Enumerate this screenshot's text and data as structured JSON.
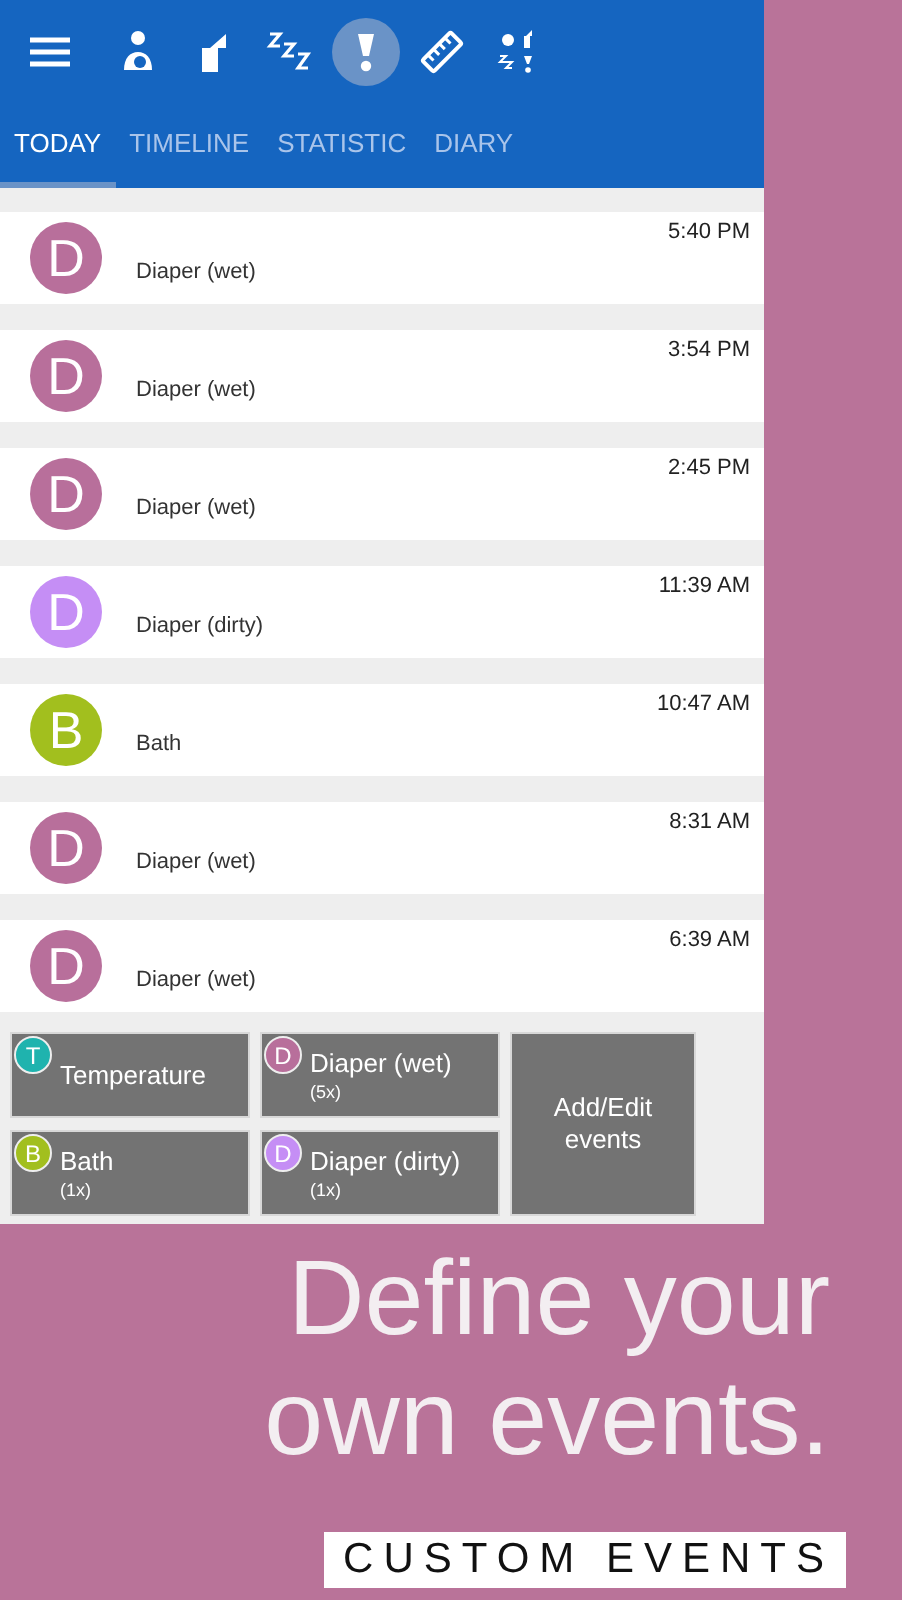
{
  "tools": [
    {
      "kind": "feeding",
      "selected": false
    },
    {
      "kind": "pumping",
      "selected": false
    },
    {
      "kind": "sleep",
      "selected": false
    },
    {
      "kind": "event",
      "selected": true
    },
    {
      "kind": "growth",
      "selected": false
    },
    {
      "kind": "all",
      "selected": false
    }
  ],
  "tabs": [
    {
      "label": "TODAY",
      "selected": true
    },
    {
      "label": "TIMELINE",
      "selected": false
    },
    {
      "label": "STATISTIC",
      "selected": false
    },
    {
      "label": "DIARY",
      "selected": false
    }
  ],
  "entries": [
    {
      "letter": "D",
      "color": "#b86f9b",
      "time": "5:40 PM",
      "name": "Diaper (wet)"
    },
    {
      "letter": "D",
      "color": "#b86f9b",
      "time": "3:54 PM",
      "name": "Diaper (wet)"
    },
    {
      "letter": "D",
      "color": "#b86f9b",
      "time": "2:45 PM",
      "name": "Diaper (wet)"
    },
    {
      "letter": "D",
      "color": "#c58ef5",
      "time": "11:39 AM",
      "name": "Diaper (dirty)"
    },
    {
      "letter": "B",
      "color": "#a2bf1e",
      "time": "10:47 AM",
      "name": "Bath"
    },
    {
      "letter": "D",
      "color": "#b86f9b",
      "time": "8:31 AM",
      "name": "Diaper (wet)"
    },
    {
      "letter": "D",
      "color": "#b86f9b",
      "time": "6:39 AM",
      "name": "Diaper (wet)"
    }
  ],
  "quick_events": [
    {
      "letter": "T",
      "color": "#1fb3ae",
      "name": "Temperature"
    },
    {
      "letter": "D",
      "color": "#b86f9b",
      "name": "Diaper (wet)",
      "count": "(5x)"
    },
    {
      "letter": "B",
      "color": "#a2bf1e",
      "name": "Bath",
      "count": "(1x)"
    },
    {
      "letter": "D",
      "color": "#c58ef5",
      "name": "Diaper (dirty)",
      "count": "(1x)"
    }
  ],
  "add_button": "Add/Edit events",
  "promo": {
    "headline": "Define your own events.",
    "caption": "CUSTOM EVENTS"
  }
}
